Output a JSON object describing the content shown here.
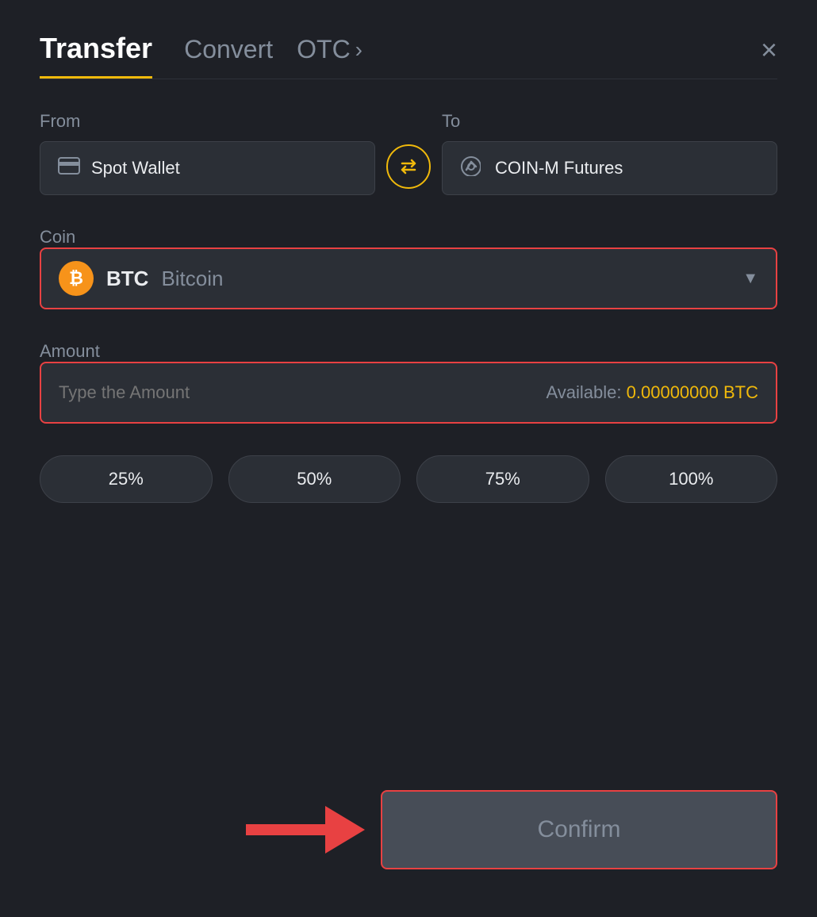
{
  "header": {
    "tab_transfer": "Transfer",
    "tab_convert": "Convert",
    "tab_otc": "OTC",
    "tab_otc_chevron": "›",
    "close": "×"
  },
  "from": {
    "label": "From",
    "wallet_name": "Spot Wallet",
    "wallet_icon": "🪪"
  },
  "to": {
    "label": "To",
    "wallet_name": "COIN-M Futures",
    "wallet_icon": "↑"
  },
  "swap": {
    "icon": "⇄"
  },
  "coin": {
    "label": "Coin",
    "symbol": "BTC",
    "name": "Bitcoin",
    "icon": "₿"
  },
  "amount": {
    "label": "Amount",
    "placeholder": "Type the Amount",
    "available_label": "Available:",
    "available_value": "0.00000000",
    "available_unit": "BTC"
  },
  "percentages": [
    {
      "label": "25%",
      "value": "25"
    },
    {
      "label": "50%",
      "value": "50"
    },
    {
      "label": "75%",
      "value": "75"
    },
    {
      "label": "100%",
      "value": "100"
    }
  ],
  "confirm_button": "Confirm",
  "colors": {
    "accent_gold": "#f0b90b",
    "accent_red": "#e84142",
    "bg_dark": "#1e2026",
    "text_muted": "#848e9c",
    "text_primary": "#eaecef"
  }
}
